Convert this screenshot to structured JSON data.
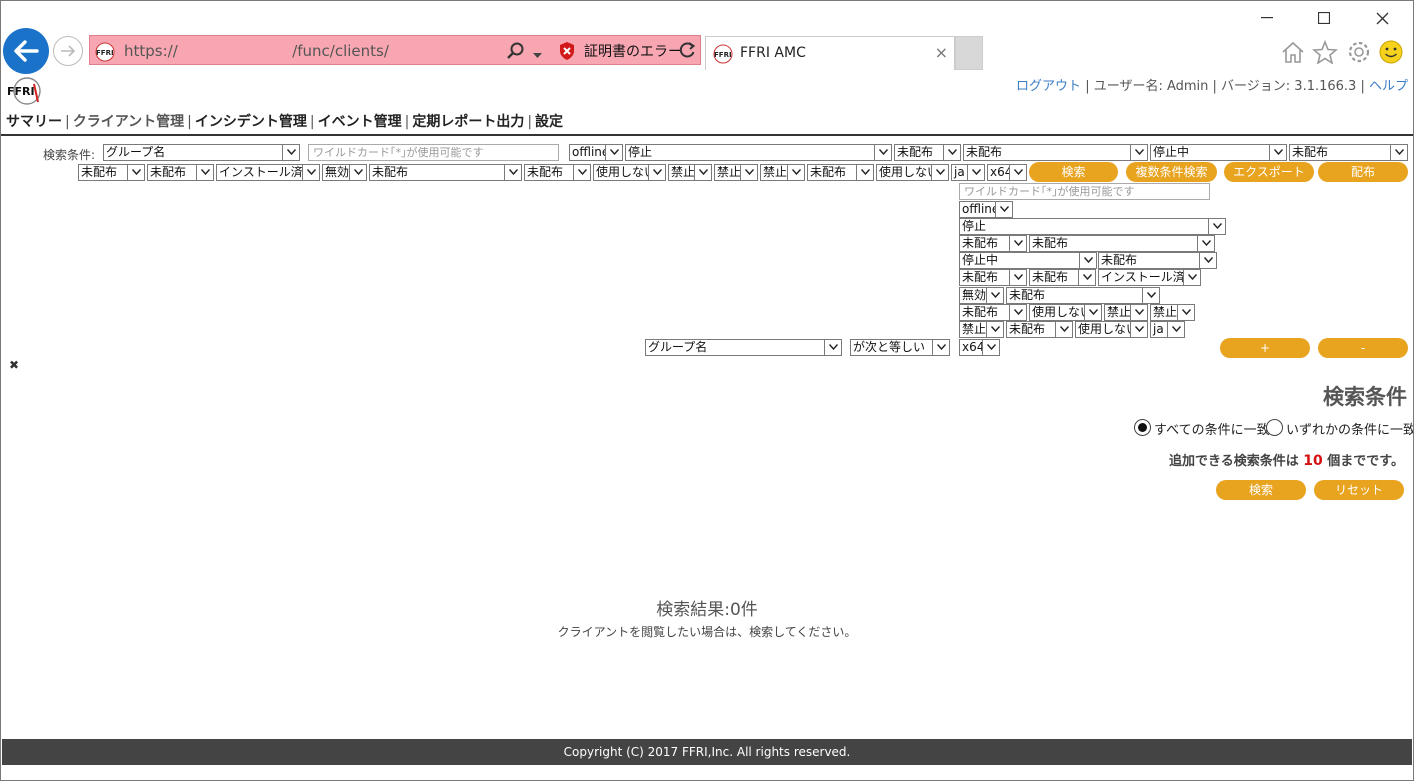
{
  "browser": {
    "url": "https://                        /func/clients/",
    "cert_error": "証明書のエラー",
    "tab_title": "FFRI AMC",
    "favicon_text": "FFRI"
  },
  "header": {
    "logo_text": "FFRI",
    "logout": "ログアウト",
    "user": "| ユーザー名: Admin | バージョン: 3.1.166.3 |",
    "help": "ヘルプ"
  },
  "nav": {
    "items": [
      "サマリー",
      "クライアント管理",
      "インシデント管理",
      "イベント管理",
      "定期レポート出力",
      "設定"
    ],
    "separator": "|"
  },
  "search_form": {
    "label": "検索条件:",
    "row1": {
      "field": "グループ名",
      "wildcard_placeholder": "ワイルドカード｢*｣が使用可能です",
      "status": "offline",
      "state": "停止",
      "s1": "未配布",
      "s2": "未配布",
      "s3": "停止中",
      "s4": "未配布"
    },
    "row2": {
      "a1": "未配布",
      "a2": "未配布",
      "a3": "インストール済み",
      "a4": "無効",
      "a5": "未配布",
      "a6": "未配布",
      "a7": "使用しない",
      "a8": "禁止",
      "a9": "禁止",
      "a10": "禁止",
      "a11": "未配布",
      "a12": "使用しない",
      "a13": "ja",
      "a14": "x64"
    },
    "buttons": {
      "search": "検索",
      "multi_search": "複数条件検索",
      "export": "エクスポート",
      "deploy": "配布"
    },
    "column": {
      "wildcard_placeholder": "ワイルドカード｢*｣が使用可能です",
      "status": "offline",
      "state": "停止",
      "c1": "未配布",
      "c2": "未配布",
      "c3": "停止中",
      "c4": "未配布",
      "c5": "未配布",
      "c6": "未配布",
      "c7": "インストール済み",
      "c8": "無効",
      "c9": "未配布",
      "c10": "未配布",
      "c11": "使用しない",
      "c12": "禁止",
      "c13": "禁止",
      "c14": "禁止",
      "c15": "未配布",
      "c16": "使用しない",
      "c17": "ja",
      "c18": "x64"
    },
    "condition_row": {
      "field": "グループ名",
      "operator": "が次と等しい",
      "plus": "+",
      "minus": "-"
    },
    "remove_icon_glyph": "✖"
  },
  "conditions_panel": {
    "title": "検索条件",
    "match_all": "すべての条件に一致",
    "match_any": "いずれかの条件に一致",
    "limit_prefix": "追加できる検索条件は",
    "limit_value": "10",
    "limit_suffix": "個までです。",
    "search": "検索",
    "reset": "リセット"
  },
  "results": {
    "title": "検索結果:0件",
    "message": "クライアントを閲覧したい場合は、検索してください。"
  },
  "footer": {
    "copyright": "Copyright (C) 2017 FFRI,Inc. All rights reserved."
  },
  "colors": {
    "accent": "#e8a31f",
    "link": "#3a7ec7",
    "error_bar": "#f8a7b2",
    "footer_bg": "#444444",
    "limit_number": "#d51010"
  }
}
